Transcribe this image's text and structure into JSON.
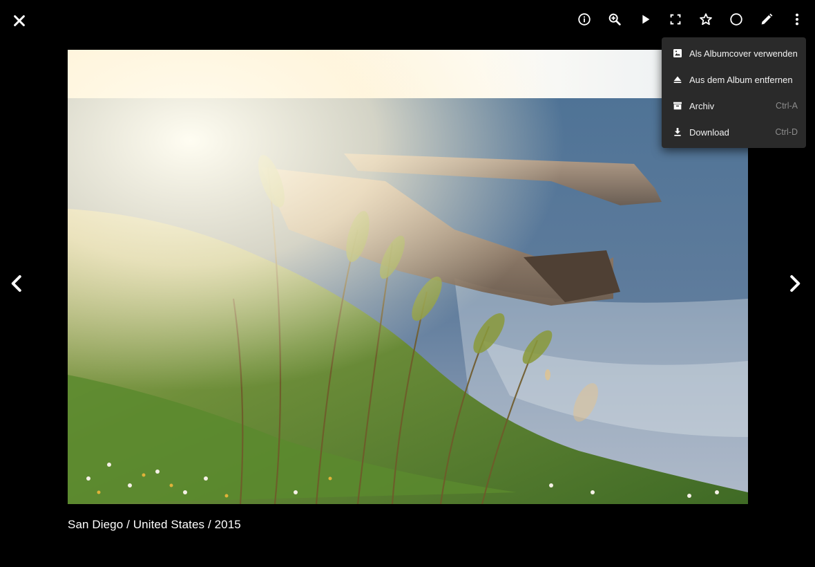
{
  "toolbar": {
    "close": {
      "icon": "close-icon"
    },
    "buttons": [
      {
        "name": "info-button",
        "icon": "info-icon"
      },
      {
        "name": "zoom-button",
        "icon": "zoom-in-icon"
      },
      {
        "name": "slideshow-button",
        "icon": "play-icon"
      },
      {
        "name": "fullscreen-button",
        "icon": "fullscreen-icon"
      },
      {
        "name": "favorite-button",
        "icon": "star-outline-icon"
      },
      {
        "name": "select-button",
        "icon": "circle-outline-icon"
      },
      {
        "name": "edit-button",
        "icon": "pencil-icon"
      },
      {
        "name": "more-button",
        "icon": "more-vertical-icon"
      }
    ]
  },
  "navigation": {
    "prev_icon": "chevron-left-icon",
    "next_icon": "chevron-right-icon"
  },
  "photo": {
    "caption": "San Diego / United States / 2015"
  },
  "menu": {
    "items": [
      {
        "label": "Als Albumcover verwenden",
        "shortcut": "",
        "icon": "image-icon"
      },
      {
        "label": "Aus dem Album entfernen",
        "shortcut": "",
        "icon": "eject-icon"
      },
      {
        "label": "Archiv",
        "shortcut": "Ctrl-A",
        "icon": "archive-icon"
      },
      {
        "label": "Download",
        "shortcut": "Ctrl-D",
        "icon": "download-icon"
      }
    ]
  },
  "colors": {
    "background": "#000000",
    "menu_background": "#2a2a2a",
    "menu_text": "#f2f2f2",
    "shortcut_text": "#8d8d8d",
    "icon": "#ffffff"
  }
}
